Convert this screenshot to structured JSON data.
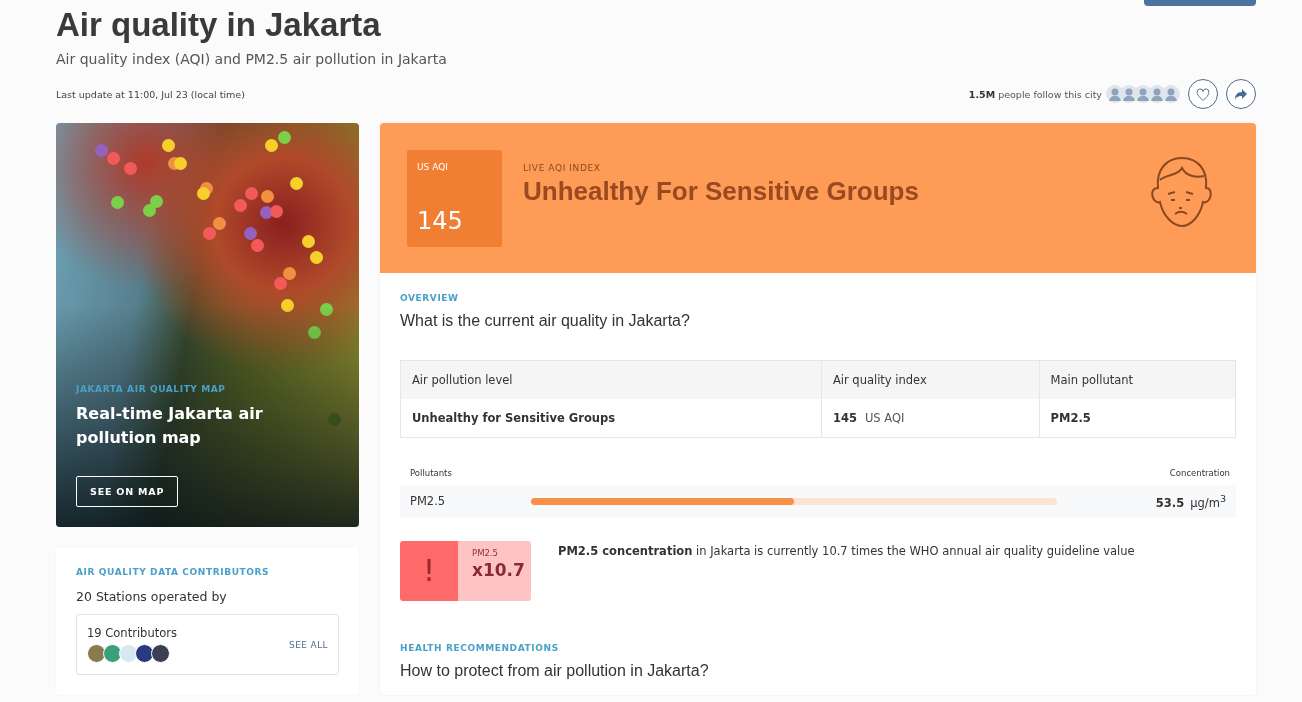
{
  "header": {
    "title": "Air quality in Jakarta",
    "subtitle": "Air quality index (AQI) and PM2.5 air pollution in Jakarta",
    "last_update": "Last update at 11:00, Jul 23 (local time)"
  },
  "followers": {
    "count": "1.5M",
    "text": "people follow this city"
  },
  "map_card": {
    "eyebrow": "JAKARTA AIR QUALITY MAP",
    "title": "Real-time Jakarta air pollution map",
    "button": "SEE ON MAP"
  },
  "contributors": {
    "eyebrow": "AIR QUALITY DATA CONTRIBUTORS",
    "stations": "20 Stations operated by",
    "count": "19 Contributors",
    "link": "SEE ALL"
  },
  "aqi": {
    "badge_label": "US AQI",
    "value": "145",
    "eyebrow": "LIVE AQI INDEX",
    "level_name": "Unhealthy For Sensitive Groups",
    "color": "#fe9b57"
  },
  "overview": {
    "eyebrow": "OVERVIEW",
    "question": "What is the current air quality in Jakarta?",
    "columns": [
      "Air pollution level",
      "Air quality index",
      "Main pollutant"
    ],
    "rows": [
      [
        {
          "text": "Unhealthy for Sensitive Groups"
        },
        {
          "text": "145",
          "unit": "US AQI"
        },
        {
          "text": "PM2.5"
        }
      ]
    ]
  },
  "pollutants": {
    "label": "Pollutants",
    "concentration_label": "Concentration",
    "items": [
      {
        "name": "PM2.5",
        "level": 0.5,
        "value": "53.5",
        "unit": "µg/m$^{3}$"
      }
    ]
  },
  "who": {
    "icon": "!",
    "label": "PM2.5",
    "multiple": "x10.7",
    "text": "**PM2.5 concentration** in Jakarta is currently 10.7 times the WHO annual air quality guideline value"
  },
  "health": {
    "eyebrow": "HEALTH RECOMMENDATIONS",
    "question": "How to protect from air pollution in Jakarta?"
  }
}
